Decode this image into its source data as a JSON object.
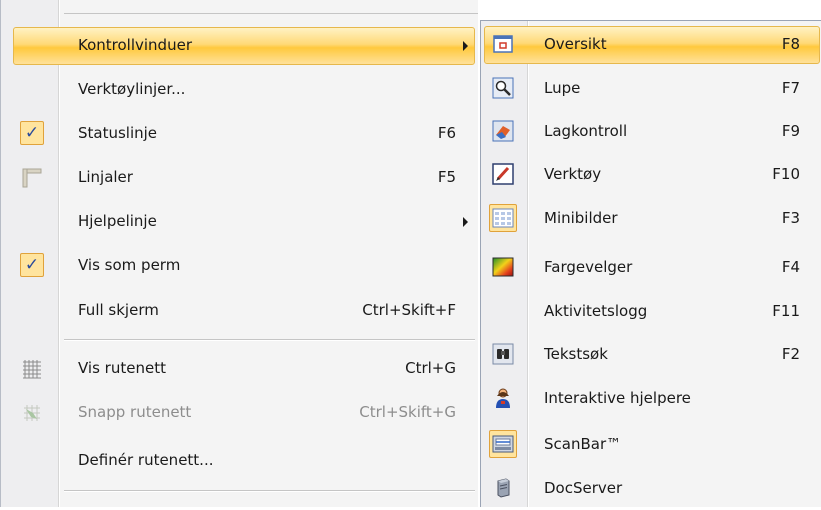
{
  "main_menu": {
    "items": [
      {
        "label": "Kontrollvinduer",
        "shortcut": "",
        "submenu": true
      },
      {
        "label": "Verktøylinjer...",
        "shortcut": ""
      },
      {
        "label": "Statuslinje",
        "shortcut": "F6",
        "checked": true
      },
      {
        "label": "Linjaler",
        "shortcut": "F5",
        "icon": "ruler-icon"
      },
      {
        "label": "Hjelpelinje",
        "shortcut": "",
        "submenu": true
      },
      {
        "label": "Vis som perm",
        "shortcut": "",
        "checked": true
      },
      {
        "label": "Full skjerm",
        "shortcut": "Ctrl+Skift+F"
      },
      {
        "label": "Vis rutenett",
        "shortcut": "Ctrl+G",
        "icon": "grid-icon"
      },
      {
        "label": "Snapp rutenett",
        "shortcut": "Ctrl+Skift+G",
        "icon": "snap-grid-icon",
        "disabled": true
      },
      {
        "label": "Definér rutenett...",
        "shortcut": ""
      }
    ],
    "check_glyph": "✓"
  },
  "submenu": {
    "items": [
      {
        "label": "Oversikt",
        "shortcut": "F8",
        "icon": "overview-window-icon"
      },
      {
        "label": "Lupe",
        "shortcut": "F7",
        "icon": "magnifier-icon"
      },
      {
        "label": "Lagkontroll",
        "shortcut": "F9",
        "icon": "layer-control-icon"
      },
      {
        "label": "Verktøy",
        "shortcut": "F10",
        "icon": "pencil-tool-icon"
      },
      {
        "label": "Minibilder",
        "shortcut": "F3",
        "icon": "thumbnails-icon"
      },
      {
        "label": "Fargevelger",
        "shortcut": "F4",
        "icon": "color-picker-icon"
      },
      {
        "label": "Aktivitetslogg",
        "shortcut": "F11"
      },
      {
        "label": "Tekstsøk",
        "shortcut": "F2",
        "icon": "binoculars-icon"
      },
      {
        "label": "Interaktive hjelpere",
        "shortcut": "",
        "icon": "person-helper-icon"
      },
      {
        "label": "ScanBar™",
        "shortcut": "",
        "icon": "scanner-icon"
      },
      {
        "label": "DocServer",
        "shortcut": "",
        "icon": "server-icon"
      }
    ]
  },
  "colors": {
    "highlight": "#ffd977",
    "highlight_border": "#e6b84c",
    "menu_bg": "#f4f4f4",
    "check_box": "#ffe49e",
    "disabled_text": "#8d8d8d"
  }
}
